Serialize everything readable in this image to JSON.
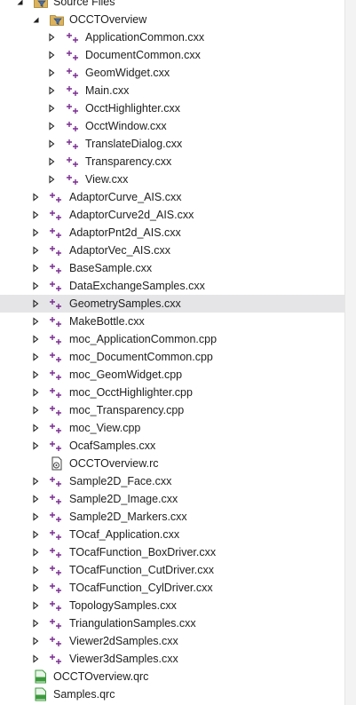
{
  "tree": {
    "rows": [
      {
        "label": "Source Files",
        "kind": "folder-filter",
        "depth": 0,
        "expander": "open-down"
      },
      {
        "label": "OCCTOverview",
        "kind": "folder-filter",
        "depth": 1,
        "expander": "open"
      },
      {
        "label": "ApplicationCommon.cxx",
        "kind": "cpp",
        "depth": 2,
        "expander": "closed"
      },
      {
        "label": "DocumentCommon.cxx",
        "kind": "cpp",
        "depth": 2,
        "expander": "closed"
      },
      {
        "label": "GeomWidget.cxx",
        "kind": "cpp",
        "depth": 2,
        "expander": "closed"
      },
      {
        "label": "Main.cxx",
        "kind": "cpp",
        "depth": 2,
        "expander": "closed"
      },
      {
        "label": "OcctHighlighter.cxx",
        "kind": "cpp",
        "depth": 2,
        "expander": "closed"
      },
      {
        "label": "OcctWindow.cxx",
        "kind": "cpp",
        "depth": 2,
        "expander": "closed"
      },
      {
        "label": "TranslateDialog.cxx",
        "kind": "cpp",
        "depth": 2,
        "expander": "closed"
      },
      {
        "label": "Transparency.cxx",
        "kind": "cpp",
        "depth": 2,
        "expander": "closed"
      },
      {
        "label": "View.cxx",
        "kind": "cpp",
        "depth": 2,
        "expander": "closed"
      },
      {
        "label": "AdaptorCurve_AIS.cxx",
        "kind": "cpp",
        "depth": 1,
        "expander": "closed"
      },
      {
        "label": "AdaptorCurve2d_AIS.cxx",
        "kind": "cpp",
        "depth": 1,
        "expander": "closed"
      },
      {
        "label": "AdaptorPnt2d_AIS.cxx",
        "kind": "cpp",
        "depth": 1,
        "expander": "closed"
      },
      {
        "label": "AdaptorVec_AIS.cxx",
        "kind": "cpp",
        "depth": 1,
        "expander": "closed"
      },
      {
        "label": "BaseSample.cxx",
        "kind": "cpp",
        "depth": 1,
        "expander": "closed"
      },
      {
        "label": "DataExchangeSamples.cxx",
        "kind": "cpp",
        "depth": 1,
        "expander": "closed"
      },
      {
        "label": "GeometrySamples.cxx",
        "kind": "cpp",
        "depth": 1,
        "expander": "closed",
        "selected": true
      },
      {
        "label": "MakeBottle.cxx",
        "kind": "cpp",
        "depth": 1,
        "expander": "closed"
      },
      {
        "label": "moc_ApplicationCommon.cpp",
        "kind": "cpp",
        "depth": 1,
        "expander": "closed"
      },
      {
        "label": "moc_DocumentCommon.cpp",
        "kind": "cpp",
        "depth": 1,
        "expander": "closed"
      },
      {
        "label": "moc_GeomWidget.cpp",
        "kind": "cpp",
        "depth": 1,
        "expander": "closed"
      },
      {
        "label": "moc_OcctHighlighter.cpp",
        "kind": "cpp",
        "depth": 1,
        "expander": "closed"
      },
      {
        "label": "moc_Transparency.cpp",
        "kind": "cpp",
        "depth": 1,
        "expander": "closed"
      },
      {
        "label": "moc_View.cpp",
        "kind": "cpp",
        "depth": 1,
        "expander": "closed"
      },
      {
        "label": "OcafSamples.cxx",
        "kind": "cpp",
        "depth": 1,
        "expander": "closed"
      },
      {
        "label": "OCCTOverview.rc",
        "kind": "rc",
        "depth": 1,
        "expander": "none"
      },
      {
        "label": "Sample2D_Face.cxx",
        "kind": "cpp",
        "depth": 1,
        "expander": "closed"
      },
      {
        "label": "Sample2D_Image.cxx",
        "kind": "cpp",
        "depth": 1,
        "expander": "closed"
      },
      {
        "label": "Sample2D_Markers.cxx",
        "kind": "cpp",
        "depth": 1,
        "expander": "closed"
      },
      {
        "label": "TOcaf_Application.cxx",
        "kind": "cpp",
        "depth": 1,
        "expander": "closed"
      },
      {
        "label": "TOcafFunction_BoxDriver.cxx",
        "kind": "cpp",
        "depth": 1,
        "expander": "closed"
      },
      {
        "label": "TOcafFunction_CutDriver.cxx",
        "kind": "cpp",
        "depth": 1,
        "expander": "closed"
      },
      {
        "label": "TOcafFunction_CylDriver.cxx",
        "kind": "cpp",
        "depth": 1,
        "expander": "closed"
      },
      {
        "label": "TopologySamples.cxx",
        "kind": "cpp",
        "depth": 1,
        "expander": "closed"
      },
      {
        "label": "TriangulationSamples.cxx",
        "kind": "cpp",
        "depth": 1,
        "expander": "closed"
      },
      {
        "label": "Viewer2dSamples.cxx",
        "kind": "cpp",
        "depth": 1,
        "expander": "closed"
      },
      {
        "label": "Viewer3dSamples.cxx",
        "kind": "cpp",
        "depth": 1,
        "expander": "closed"
      },
      {
        "label": "OCCTOverview.qrc",
        "kind": "qrc",
        "depth": 0,
        "expander": "none"
      },
      {
        "label": "Samples.qrc",
        "kind": "qrc",
        "depth": 0,
        "expander": "none"
      }
    ]
  },
  "colors": {
    "selected_row": "#e5e5e8",
    "cpp_icon": "#7a2d91",
    "folder": "#dcb35c",
    "qrc_icon": "#3c9a3c",
    "chevron": "#1e1e1e"
  },
  "icons": {
    "cpp": "cpp-file-icon",
    "rc": "resource-file-icon",
    "qrc": "qrc-file-icon",
    "folder-filter": "filter-folder-icon"
  }
}
